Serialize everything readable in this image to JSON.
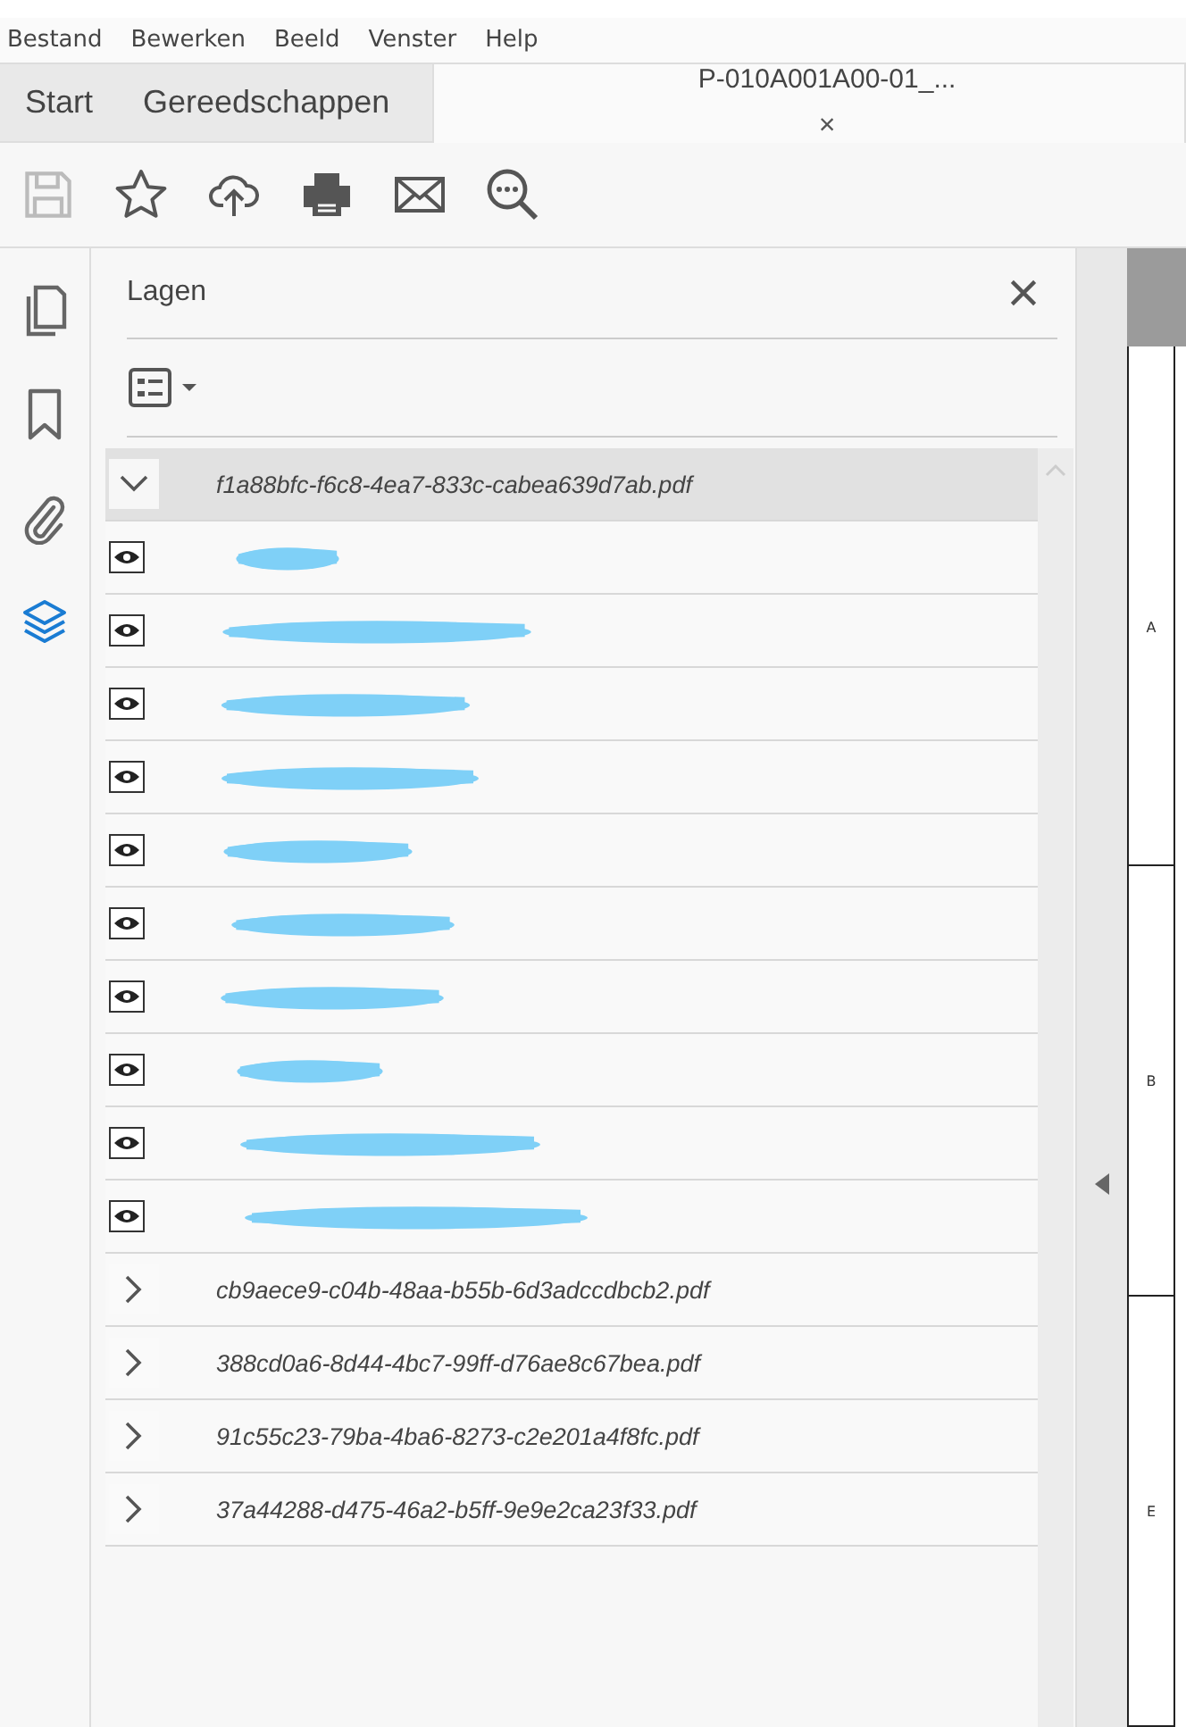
{
  "menu": [
    "Bestand",
    "Bewerken",
    "Beeld",
    "Venster",
    "Help"
  ],
  "tabs": [
    {
      "label": "Start",
      "selected": false
    },
    {
      "label": "Gereedschappen",
      "selected": false
    },
    {
      "label": "P-010A001A00-01_...",
      "selected": true,
      "close": "×"
    }
  ],
  "toolbar": [
    {
      "kind": "save",
      "disabled": true
    },
    {
      "kind": "star",
      "disabled": false
    },
    {
      "kind": "upload",
      "disabled": false
    },
    {
      "kind": "print",
      "disabled": false
    },
    {
      "kind": "mail",
      "disabled": false
    },
    {
      "kind": "search",
      "disabled": false
    }
  ],
  "rail": [
    {
      "kind": "pages",
      "selected": false
    },
    {
      "kind": "bookmark",
      "selected": false
    },
    {
      "kind": "attachment",
      "selected": false
    },
    {
      "kind": "layers",
      "selected": true
    }
  ],
  "panel": {
    "title": "Lagen",
    "layers": [
      {
        "name": "f1a88bfc-f6c8-4ea7-833c-cabea639d7ab.pdf",
        "expanded": true,
        "selected": true,
        "children": [
          {
            "visible": true,
            "redacted": true
          },
          {
            "visible": true,
            "redacted": true
          },
          {
            "visible": true,
            "redacted": true
          },
          {
            "visible": true,
            "redacted": true
          },
          {
            "visible": true,
            "redacted": true
          },
          {
            "visible": true,
            "redacted": true
          },
          {
            "visible": true,
            "redacted": true
          },
          {
            "visible": true,
            "redacted": true
          },
          {
            "visible": true,
            "redacted": true
          },
          {
            "visible": true,
            "redacted": true
          }
        ]
      },
      {
        "name": "cb9aece9-c04b-48aa-b55b-6d3adccdbcb2.pdf",
        "expanded": false,
        "selected": false
      },
      {
        "name": "388cd0a6-8d44-4bc7-99ff-d76ae8c67bea.pdf",
        "expanded": false,
        "selected": false
      },
      {
        "name": "91c55c23-79ba-4ba6-8273-c2e201a4f8fc.pdf",
        "expanded": false,
        "selected": false
      },
      {
        "name": "37a44288-d475-46a2-b5ff-9e9e2ca23f33.pdf",
        "expanded": false,
        "selected": false
      }
    ]
  },
  "document": {
    "zone_labels": [
      "A",
      "B",
      "E"
    ]
  }
}
